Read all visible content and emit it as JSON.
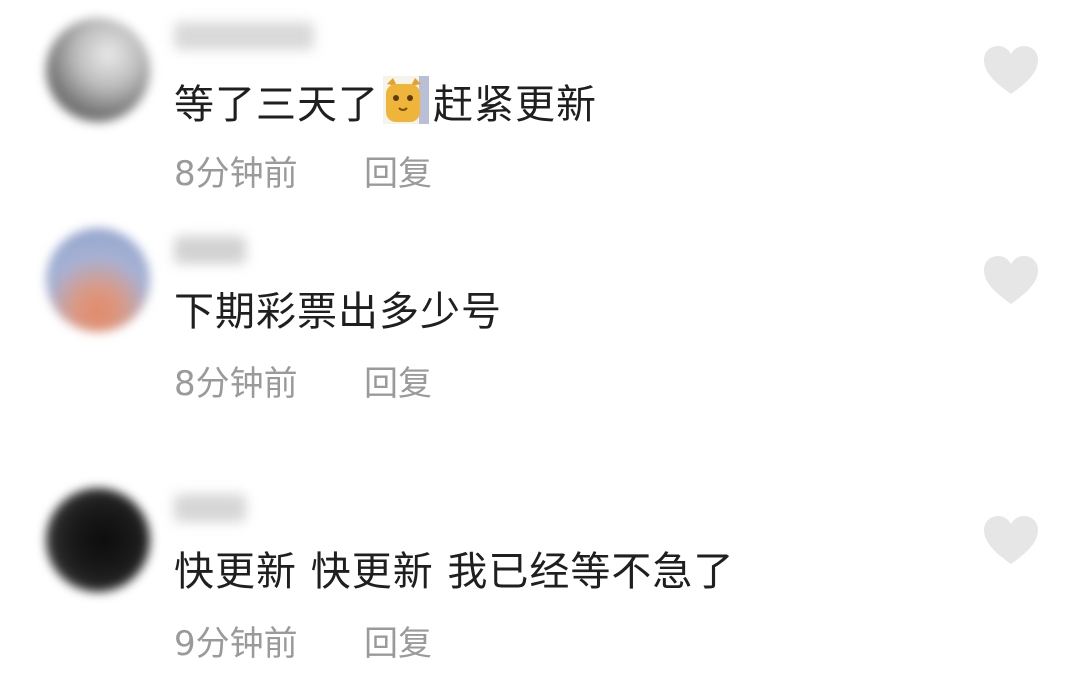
{
  "colors": {
    "text": "#1f1f1f",
    "meta": "#9a9a9a",
    "heart": "#e6e6e6"
  },
  "comments": [
    {
      "text_before": "等了三天了",
      "emoji": "cat-face-emoji",
      "text_after": "赶紧更新",
      "time": "8分钟前",
      "reply": "回复",
      "avatar_colors": [
        "#6a6a6a",
        "#c9c9c9"
      ],
      "username_color": "#d8d8d8"
    },
    {
      "text": "下期彩票出多少号",
      "time": "8分钟前",
      "reply": "回复",
      "avatar_colors": [
        "#8c9fc8",
        "#e38a6a"
      ],
      "username_color": "#d0d0d0"
    },
    {
      "text": "快更新 快更新 我已经等不急了",
      "time": "9分钟前",
      "reply": "回复",
      "avatar_colors": [
        "#111111",
        "#444444"
      ],
      "username_color": "#d6d6d6"
    }
  ]
}
